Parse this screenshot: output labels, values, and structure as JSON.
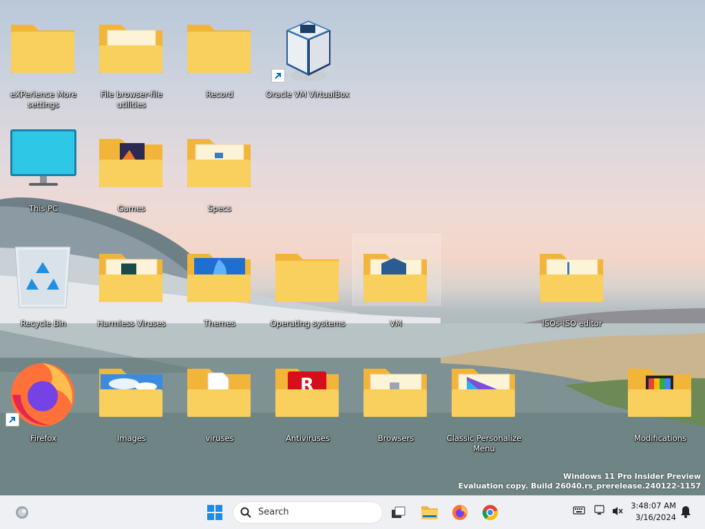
{
  "desktop": {
    "icons": [
      {
        "label": "eXPerience More settings",
        "icon": "folder-icon"
      },
      {
        "label": "File browser-file utilities",
        "icon": "folder-icon"
      },
      {
        "label": "Record",
        "icon": "folder-icon"
      },
      {
        "label": "Oracle VM VirtualBox",
        "icon": "virtualbox-icon"
      },
      {
        "label": "This PC",
        "icon": "monitor-icon"
      },
      {
        "label": "Games",
        "icon": "folder-icon"
      },
      {
        "label": "Specs",
        "icon": "folder-icon"
      },
      {
        "label": "Recycle Bin",
        "icon": "recycle-bin-icon"
      },
      {
        "label": "Harmless Viruses",
        "icon": "folder-icon"
      },
      {
        "label": "Themes",
        "icon": "folder-icon"
      },
      {
        "label": "Operating systems",
        "icon": "folder-icon"
      },
      {
        "label": "VM",
        "icon": "folder-icon"
      },
      {
        "label": "ISOs-ISO editor",
        "icon": "folder-icon"
      },
      {
        "label": "Firefox",
        "icon": "firefox-icon"
      },
      {
        "label": "Images",
        "icon": "folder-icon"
      },
      {
        "label": "viruses",
        "icon": "folder-icon"
      },
      {
        "label": "Antiviruses",
        "icon": "folder-icon"
      },
      {
        "label": "Browsers",
        "icon": "folder-icon"
      },
      {
        "label": "Classic Personalize Menu",
        "icon": "folder-icon"
      },
      {
        "label": "Modifications",
        "icon": "folder-icon"
      }
    ]
  },
  "watermark": {
    "line1": "Windows 11 Pro Insider Preview",
    "line2": "Evaluation copy. Build 26040.rs_prerelease.240122-1157"
  },
  "taskbar": {
    "search_placeholder": "Search",
    "pinned": [
      "start-icon",
      "search-icon",
      "task-view-icon",
      "file-explorer-icon",
      "firefox-icon",
      "chrome-icon"
    ],
    "tray": [
      "keyboard-icon",
      "network-icon",
      "volume-muted-icon",
      "notification-bell-icon"
    ],
    "time": "3:48:07 AM",
    "date": "3/16/2024"
  },
  "colors": {
    "folder": "#f8cd58",
    "folder_back": "#f3b43a",
    "accent": "#0067c0",
    "taskbar": "#eef0f4"
  }
}
